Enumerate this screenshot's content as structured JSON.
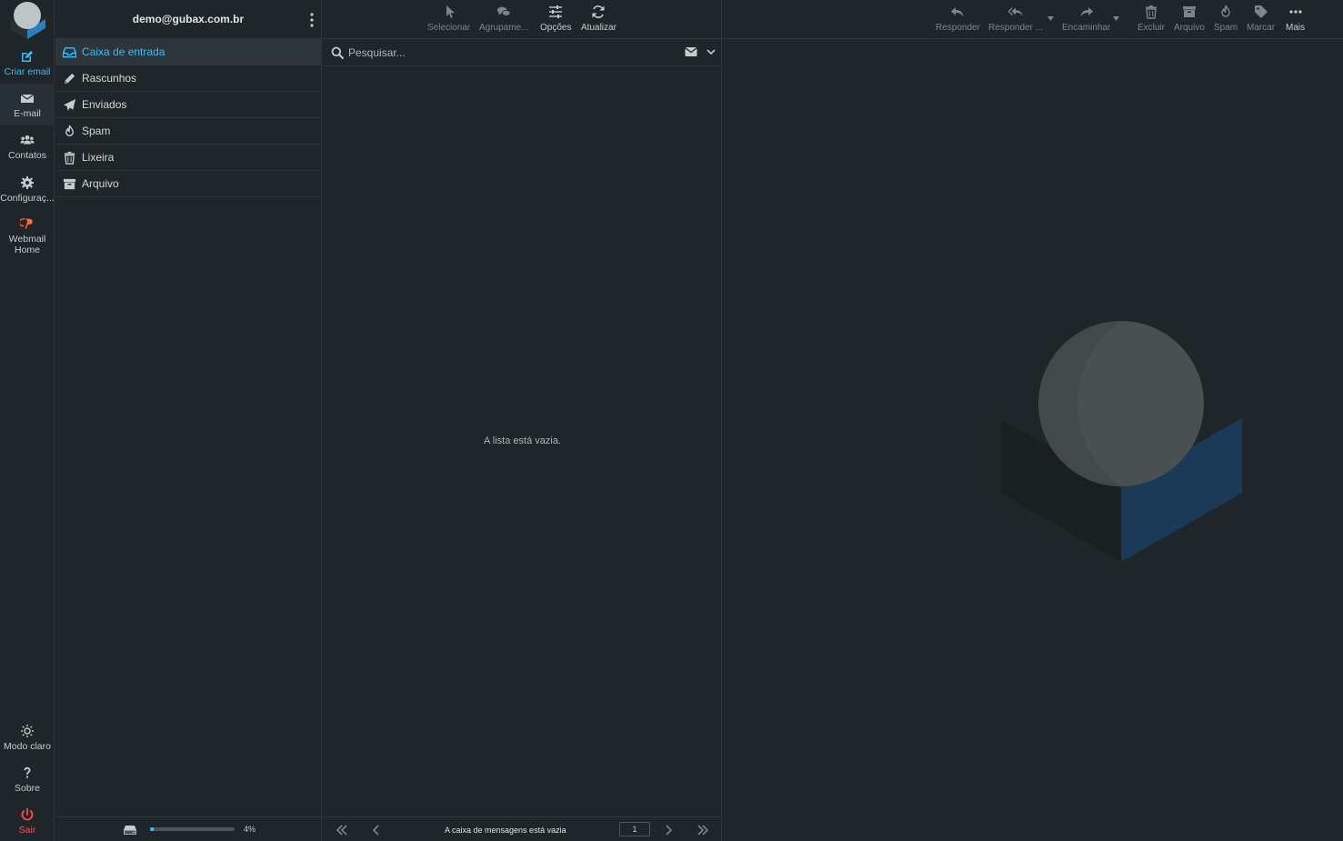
{
  "account": {
    "email": "demo@gubax.com.br"
  },
  "appnav": {
    "compose": "Criar email",
    "mail": "E-mail",
    "contacts": "Contatos",
    "settings": "Configuraç...",
    "cpanel": "Webmail Home",
    "theme": "Modo claro",
    "about": "Sobre",
    "logout": "Sair"
  },
  "folders": [
    {
      "label": "Caixa de entrada",
      "icon": "inbox-icon",
      "selected": true
    },
    {
      "label": "Rascunhos",
      "icon": "pencil-icon",
      "selected": false
    },
    {
      "label": "Enviados",
      "icon": "paper-plane-icon",
      "selected": false
    },
    {
      "label": "Spam",
      "icon": "fire-icon",
      "selected": false
    },
    {
      "label": "Lixeira",
      "icon": "trash-icon",
      "selected": false
    },
    {
      "label": "Arquivo",
      "icon": "archive-icon",
      "selected": false
    }
  ],
  "quota": {
    "percent": 4,
    "label": "4%"
  },
  "list_toolbar": {
    "select": "Selecionar",
    "threads": "Agrupame...",
    "options": "Opções",
    "refresh": "Atualizar"
  },
  "search": {
    "placeholder": "Pesquisar..."
  },
  "message_list": {
    "empty_text": "A lista está vazia."
  },
  "list_footer": {
    "status": "A caixa de mensagens está vazia",
    "page": "1"
  },
  "message_toolbar": {
    "reply": "Responder",
    "reply_all": "Responder ...",
    "forward": "Encaminhar",
    "delete": "Excluir",
    "archive": "Arquivo",
    "spam": "Spam",
    "mark": "Marcar",
    "more": "Mais"
  },
  "colors": {
    "background": "#1f2528",
    "accent": "#37beff",
    "logout": "#ff4d4d",
    "cpanel": "#ff6c2c"
  }
}
